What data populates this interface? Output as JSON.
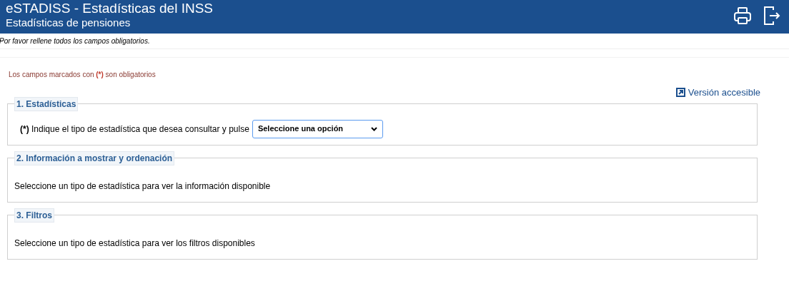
{
  "header": {
    "title": "eSTADISS - Estadísticas del INSS",
    "subtitle": "Estadísticas de pensiones"
  },
  "notice": "Por favor rellene todos los campos obligatorios.",
  "required_note": {
    "before": "Los campos marcados con ",
    "mark": "(*)",
    "after": " son obligatorios"
  },
  "accessible_link": "Versión accesible",
  "sections": [
    {
      "legend": "1. Estadísticas",
      "kind": "select",
      "mark": "(*)",
      "text": "Indique el tipo de estadística que desea consultar y pulse",
      "select": {
        "value": "Seleccione una opción"
      }
    },
    {
      "legend": "2. Información a mostrar y ordenación",
      "kind": "message",
      "text": "Seleccione un tipo de estadística para ver la información disponible"
    },
    {
      "legend": "3. Filtros",
      "kind": "message",
      "text": "Seleccione un tipo de estadística para ver los filtros disponibles"
    }
  ]
}
